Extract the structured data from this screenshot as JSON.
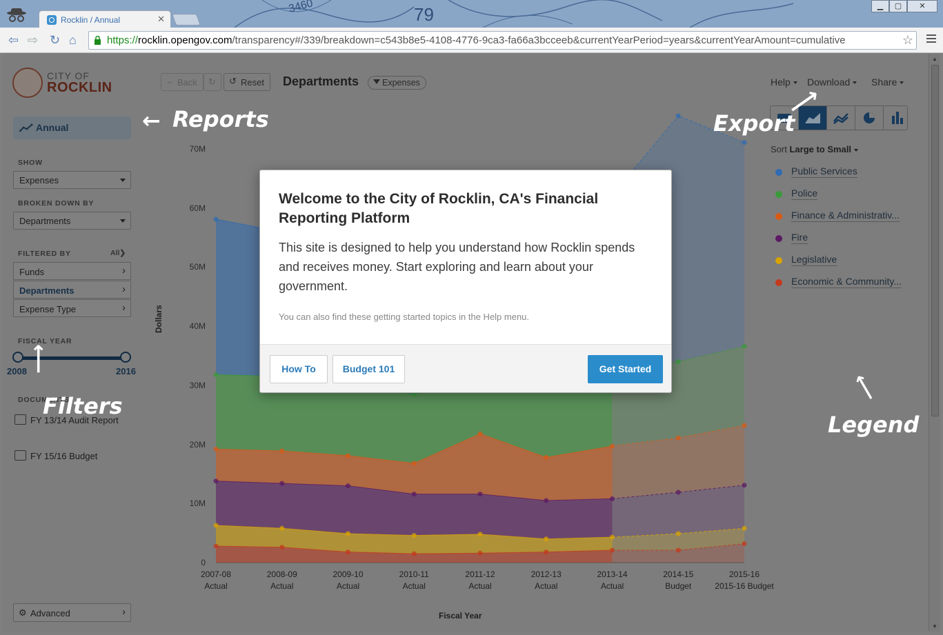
{
  "browser": {
    "tab_title": "Rocklin / Annual",
    "url_scheme": "https://",
    "url_host": "rocklin.opengov.com",
    "url_path": "/transparency#/339/breakdown=c543b8e5-4108-4776-9ca3-fa66a3bcceeb&currentYearPeriod=years&currentYearAmount=cumulative"
  },
  "logo": {
    "line1": "CITY OF",
    "line2": "ROCKLIN"
  },
  "sidebar": {
    "report": "Annual",
    "show_label": "SHOW",
    "show_value": "Expenses",
    "breakdown_label": "BROKEN DOWN BY",
    "breakdown_value": "Departments",
    "filtered_label": "FILTERED BY",
    "all_label": "All",
    "filters": [
      "Funds",
      "Departments",
      "Expense Type"
    ],
    "fiscal_label": "FISCAL YEAR",
    "year_start": "2008",
    "year_end": "2016",
    "documents_label": "DOCUMENTS",
    "documents": [
      "FY 13/14 Audit Report",
      "FY 15/16 Budget"
    ],
    "advanced": "Advanced"
  },
  "header": {
    "back": "Back",
    "reset": "Reset",
    "title": "Departments",
    "filter_pill": "Expenses",
    "menus": [
      "Help",
      "Download",
      "Share"
    ]
  },
  "sort": {
    "label": "Sort",
    "value": "Large to Small"
  },
  "legend": [
    {
      "name": "Public Services",
      "color": "#2f6bb2"
    },
    {
      "name": "Police",
      "color": "#3a9a3a"
    },
    {
      "name": "Finance & Administrativ...",
      "color": "#d85a14"
    },
    {
      "name": "Fire",
      "color": "#5b1a63"
    },
    {
      "name": "Legislative",
      "color": "#d9a300"
    },
    {
      "name": "Economic & Community...",
      "color": "#c33a1c"
    }
  ],
  "annotations": {
    "reports": "Reports",
    "export": "Export",
    "filters": "Filters",
    "legend": "Legend"
  },
  "modal": {
    "title": "Welcome to the City of Rocklin, CA's Financial Reporting Platform",
    "body": "This site is designed to help you understand how Rocklin spends and receives money. Start exploring and learn about your government.",
    "small": "You can also find these getting started topics in the Help menu.",
    "btn_howto": "How To",
    "btn_budget": "Budget 101",
    "btn_start": "Get Started"
  },
  "chart_data": {
    "type": "area",
    "stacked": true,
    "xlabel": "Fiscal Year",
    "ylabel": "Dollars",
    "ylim": [
      0,
      70000000
    ],
    "y_ticks": [
      "0",
      "10M",
      "20M",
      "30M",
      "40M",
      "50M",
      "60M",
      "70M"
    ],
    "categories": [
      "2007-08",
      "2008-09",
      "2009-10",
      "2010-11",
      "2011-12",
      "2012-13",
      "2013-14",
      "2014-15",
      "2015-16"
    ],
    "category_sublabels": [
      "Actual",
      "Actual",
      "Actual",
      "Actual",
      "Actual",
      "Actual",
      "Actual",
      "Budget",
      "2015-16 Budget"
    ],
    "projected_from_index": 6,
    "cumulative_series": [
      {
        "name": "Economic & Community...",
        "values": [
          2.8,
          2.6,
          1.8,
          1.5,
          1.6,
          1.8,
          2.1,
          2.1,
          3.2
        ]
      },
      {
        "name": "Legislative",
        "values": [
          6.3,
          5.8,
          4.9,
          4.6,
          4.8,
          4.0,
          4.3,
          4.9,
          5.8
        ]
      },
      {
        "name": "Fire",
        "values": [
          13.8,
          13.4,
          13.0,
          11.6,
          11.6,
          10.5,
          10.8,
          11.9,
          13.1
        ]
      },
      {
        "name": "Finance & Administrativ...",
        "values": [
          19.2,
          18.9,
          18.1,
          16.8,
          21.8,
          17.8,
          19.7,
          21.1,
          23.2
        ]
      },
      {
        "name": "Police",
        "values": [
          31.8,
          31.5,
          30.2,
          28.5,
          31.3,
          31.1,
          32.6,
          34.0,
          36.6
        ]
      },
      {
        "name": "Public Services",
        "values": [
          58.1,
          56.0,
          55.5,
          54.6,
          59.4,
          60.3,
          62.2,
          75.6,
          71.1
        ]
      }
    ]
  }
}
